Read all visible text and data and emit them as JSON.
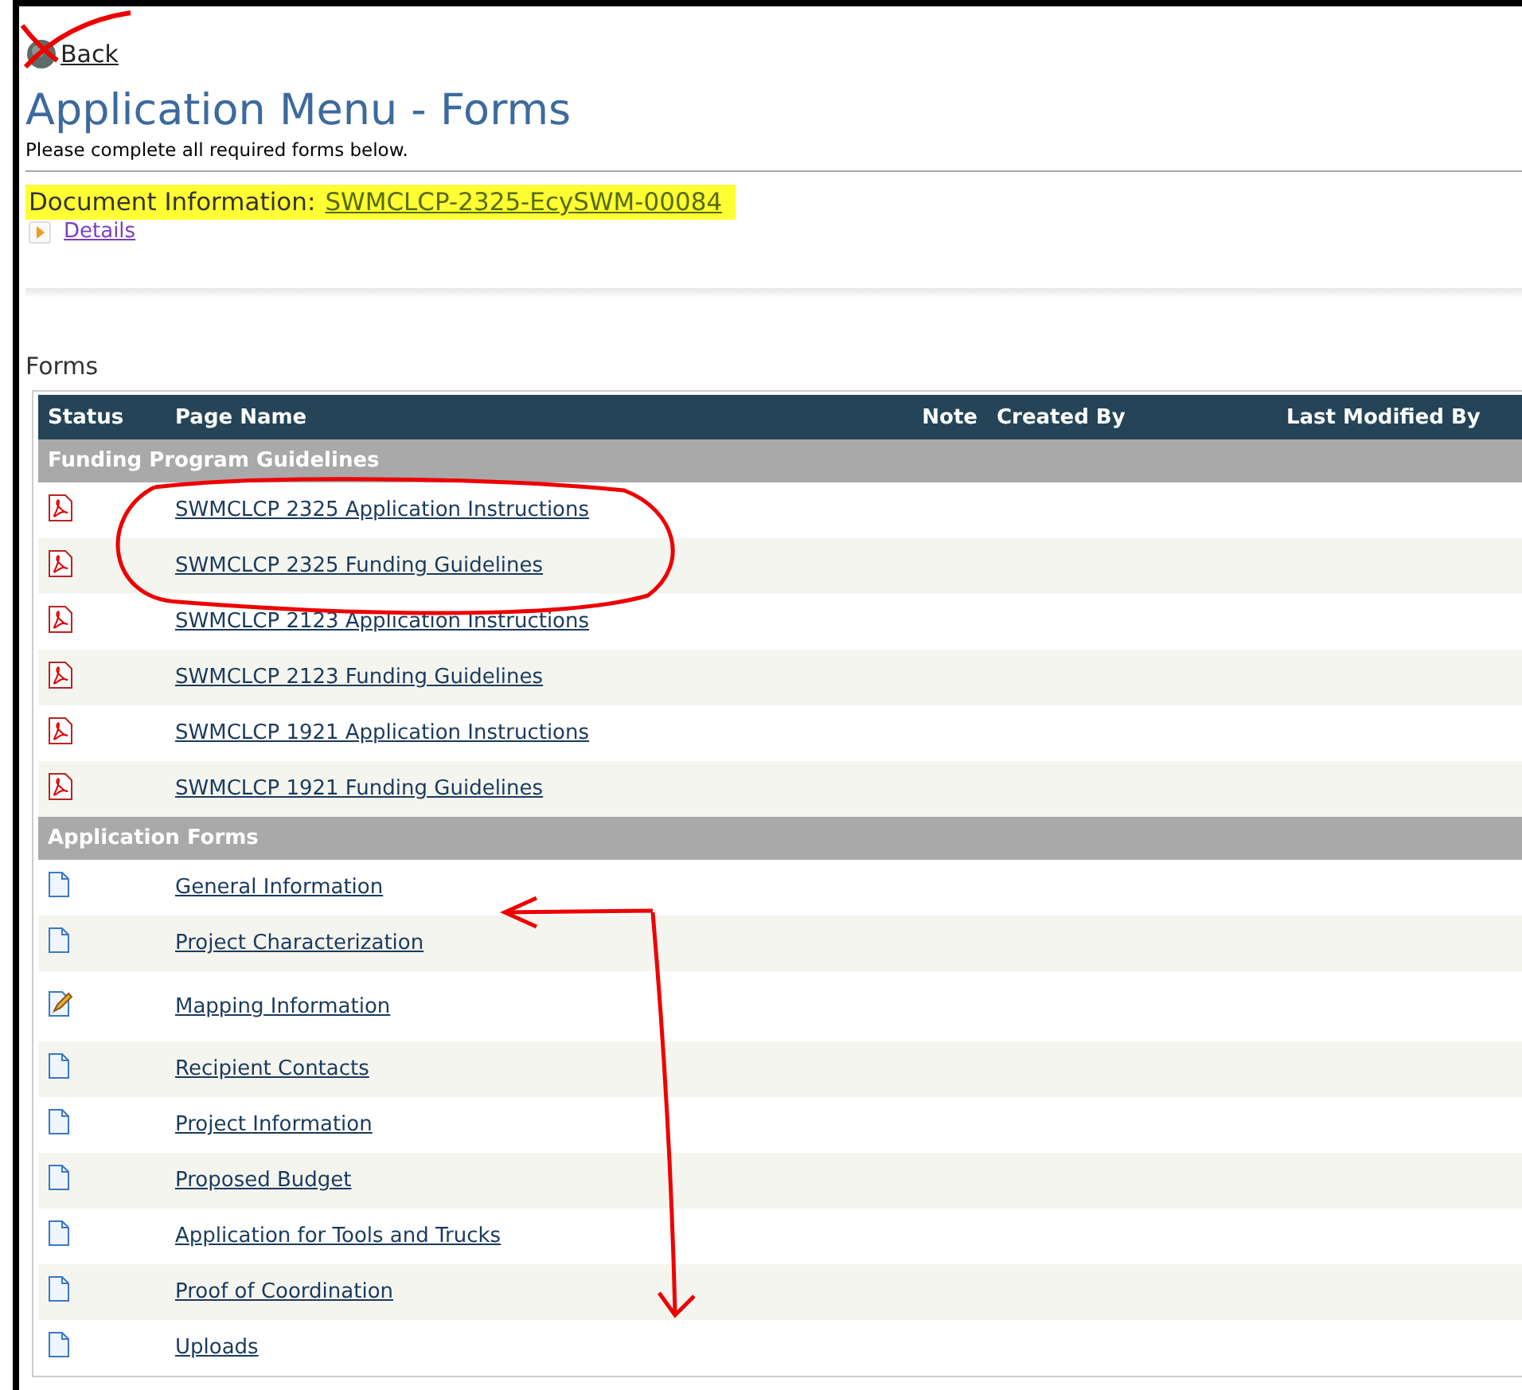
{
  "back_link": "Back",
  "title": "Application Menu - Forms",
  "subtitle": "Please complete all required forms below.",
  "document_info": {
    "label": "Document Information:",
    "value": "SWMCLCP-2325-EcySWM-00084",
    "details_link": "Details",
    "expanded": false
  },
  "forms_label": "Forms",
  "table": {
    "columns": [
      "Status",
      "Page Name",
      "Note",
      "Created By",
      "Last Modified By"
    ],
    "groups": [
      {
        "name": "Funding Program Guidelines",
        "rows": [
          {
            "kind": "pdf",
            "page_name": "SWMCLCP 2325 Application Instructions"
          },
          {
            "kind": "pdf",
            "page_name": "SWMCLCP 2325 Funding Guidelines"
          },
          {
            "kind": "pdf",
            "page_name": "SWMCLCP 2123 Application Instructions"
          },
          {
            "kind": "pdf",
            "page_name": "SWMCLCP 2123 Funding Guidelines"
          },
          {
            "kind": "pdf",
            "page_name": "SWMCLCP 1921 Application Instructions"
          },
          {
            "kind": "pdf",
            "page_name": "SWMCLCP 1921 Funding Guidelines"
          }
        ]
      },
      {
        "name": "Application Forms",
        "rows": [
          {
            "kind": "blank",
            "page_name": "General Information"
          },
          {
            "kind": "blank",
            "page_name": "Project Characterization"
          },
          {
            "kind": "edited",
            "page_name": "Mapping Information"
          },
          {
            "kind": "blank",
            "page_name": "Recipient Contacts"
          },
          {
            "kind": "blank",
            "page_name": "Project Information"
          },
          {
            "kind": "blank",
            "page_name": "Proposed Budget"
          },
          {
            "kind": "blank",
            "page_name": "Application for Tools and Trucks"
          },
          {
            "kind": "blank",
            "page_name": "Proof of Coordination"
          },
          {
            "kind": "blank",
            "page_name": "Uploads"
          }
        ]
      }
    ]
  }
}
